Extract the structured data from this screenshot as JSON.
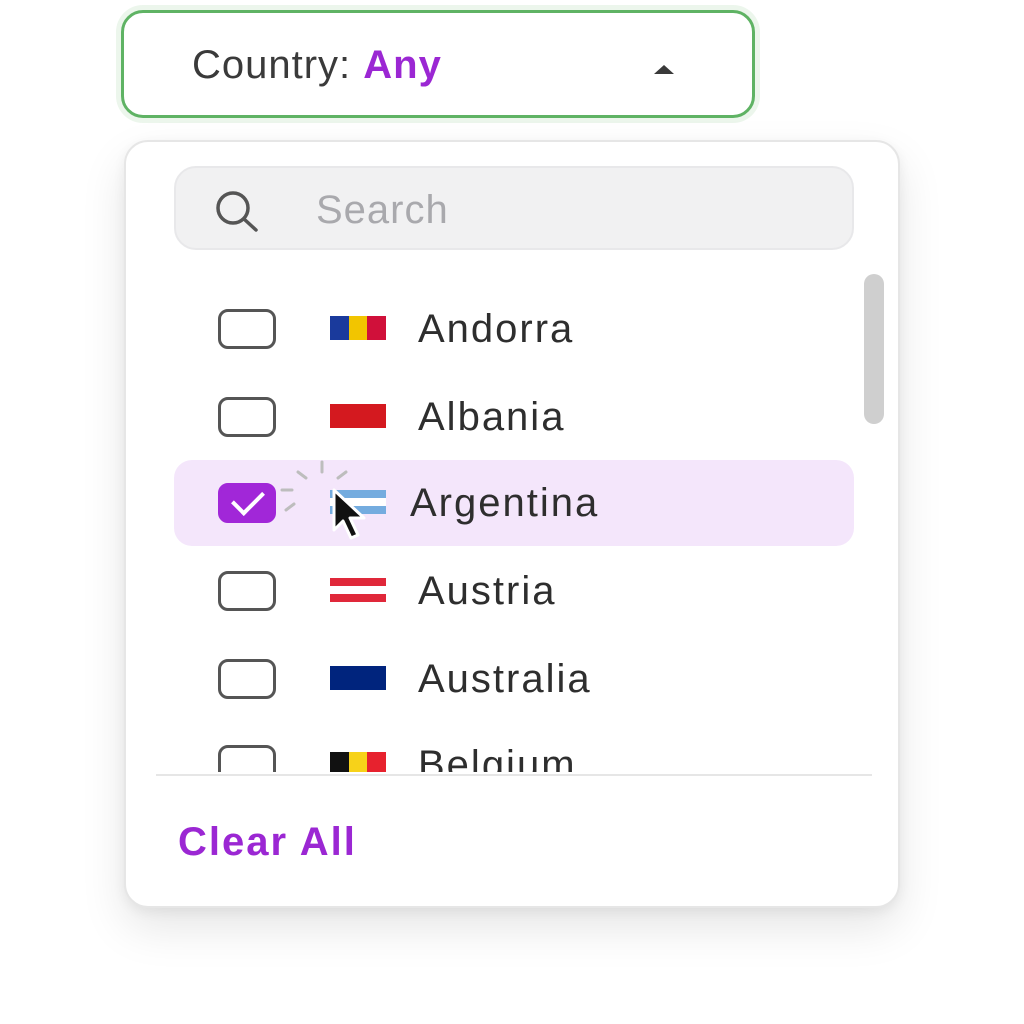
{
  "trigger": {
    "label": "Country:",
    "value": "Any",
    "caret_icon": "caret-up-icon"
  },
  "search": {
    "placeholder": "Search",
    "icon": "search-icon"
  },
  "countries": [
    {
      "name": "Andorra",
      "checked": false,
      "flag_colors": [
        "#1a3a9c",
        "#f2c500",
        "#d0103a"
      ]
    },
    {
      "name": "Albania",
      "checked": false,
      "flag_colors": [
        "#d4191f"
      ]
    },
    {
      "name": "Argentina",
      "checked": true,
      "flag_colors": [
        "#74acdf",
        "#ffffff",
        "#74acdf"
      ]
    },
    {
      "name": "Austria",
      "checked": false,
      "flag_colors": [
        "#e0283a",
        "#ffffff",
        "#e0283a"
      ]
    },
    {
      "name": "Australia",
      "checked": false,
      "flag_colors": [
        "#00247d"
      ]
    },
    {
      "name": "Belgium",
      "checked": false,
      "flag_colors": [
        "#111111",
        "#f7d219",
        "#e7222e"
      ]
    }
  ],
  "footer": {
    "clear_all_label": "Clear All"
  },
  "colors": {
    "accent": "#9b27d3",
    "focus_border": "#5fb364",
    "selected_row_bg": "#f4e6fb"
  }
}
